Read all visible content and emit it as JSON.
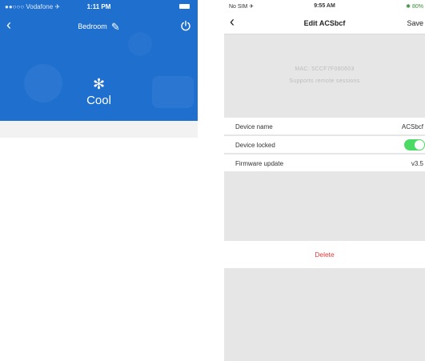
{
  "left_screen": {
    "status": {
      "carrier": "●●○○○ Vodafone ✈",
      "time": "1:11 PM"
    },
    "nav": {
      "title": "Bedroom",
      "back_icon": "chevron-left-icon",
      "edit_icon": "pencil-icon",
      "power_icon": "power-icon"
    },
    "mode": {
      "icon": "snowflake-icon",
      "label": "Cool"
    },
    "colors": {
      "background": "#1f6fcf",
      "footer": "#f2f2f2"
    }
  },
  "right_screen": {
    "status": {
      "carrier": "No SIM ✈",
      "time": "9:55 AM",
      "battery": "✱ 80%"
    },
    "nav": {
      "title": "Edit ACSbcf",
      "save_label": "Save",
      "back_icon": "chevron-left-icon"
    },
    "info": {
      "line1": "MAC: 5CCF7F080603",
      "line2": "Supports remote sessions"
    },
    "rows": [
      {
        "label": "Device name",
        "value": "ACSbcf"
      },
      {
        "label": "Device locked",
        "toggle_on": true
      },
      {
        "label": "Firmware update",
        "value": "v3.5"
      }
    ],
    "delete_label": "Delete",
    "colors": {
      "toggle": "#4cd964",
      "delete": "#e53935",
      "background": "#e6e6e6"
    }
  }
}
